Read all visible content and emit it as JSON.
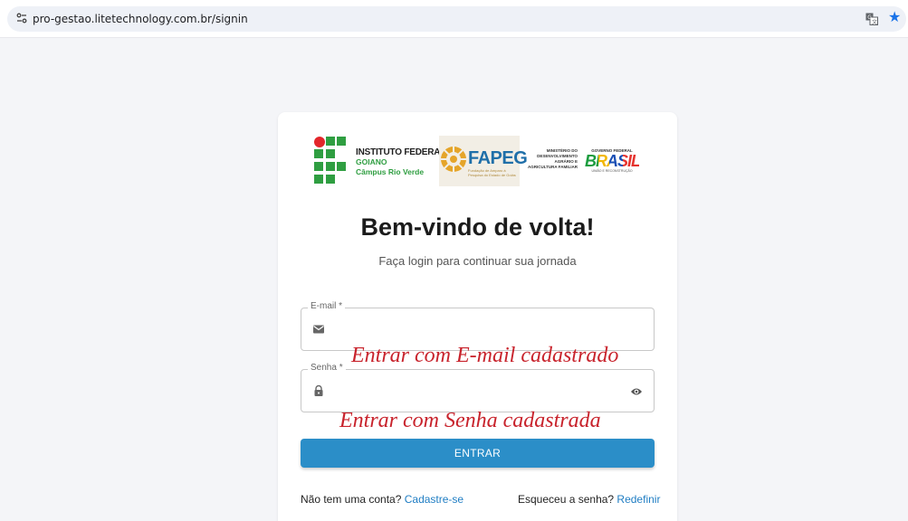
{
  "browser": {
    "url": "pro-gestao.litetechnology.com.br/signin",
    "site_info_icon": "tune-icon",
    "translate_icon": "translate-icon",
    "bookmark_icon": "star-icon"
  },
  "logos": {
    "if_title": "INSTITUTO FEDERAL",
    "if_line2": "GOIANO",
    "if_line3": "Câmpus Rio Verde",
    "fapeg": "FAPEG",
    "fapeg_sub": "Fundação de Amparo à Pesquisa do Estado de Goiás",
    "ministerio": "MINISTÉRIO DO DESENVOLVIMENTO AGRÁRIO E AGRICULTURA FAMILIAR",
    "gov_top": "GOVERNO FEDERAL",
    "gov_word": "BRASIL",
    "gov_bottom": "UNIÃO E RECONSTRUÇÃO"
  },
  "login": {
    "heading": "Bem-vindo de volta!",
    "subheading": "Faça login para continuar sua jornada",
    "email_label": "E-mail *",
    "email_value": "",
    "senha_label": "Senha *",
    "senha_value": "",
    "email_annotation": "Entrar com E-mail cadastrado",
    "senha_annotation": "Entrar com Senha cadastrada",
    "enter_button": "ENTRAR",
    "no_account": "Não tem uma conta? ",
    "register_link": "Cadastre-se",
    "forgot": "Esqueceu a senha? ",
    "reset_link": "Redefinir"
  },
  "colors": {
    "primary": "#2b8ec8",
    "link": "#1f7dc3",
    "annotation": "#c8232c",
    "if_green": "#2f9e41",
    "if_red": "#e3262b"
  }
}
